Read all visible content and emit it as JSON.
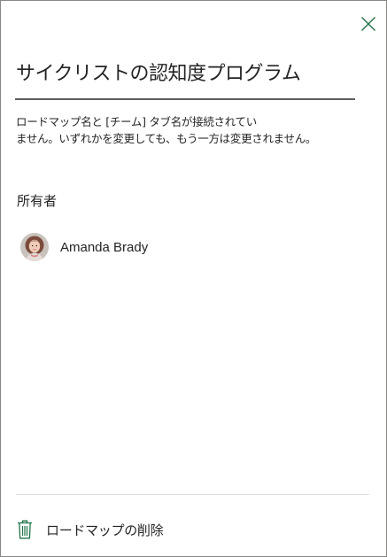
{
  "panel": {
    "title": "サイクリストの認知度プログラム",
    "description_line1": "ロードマップ名と [チーム] タブ名が接続されてい",
    "description_line2": "ません。いずれかを変更しても、もう一方は変更されません。",
    "owner_heading": "所有者",
    "owner_name": "Amanda Brady",
    "delete_label": "ロードマップの削除",
    "close_icon": "close-icon",
    "delete_icon": "trash-icon"
  },
  "colors": {
    "accent": "#217346",
    "text": "#252423",
    "underline": "#605e5c",
    "divider": "#e1dfdd"
  }
}
